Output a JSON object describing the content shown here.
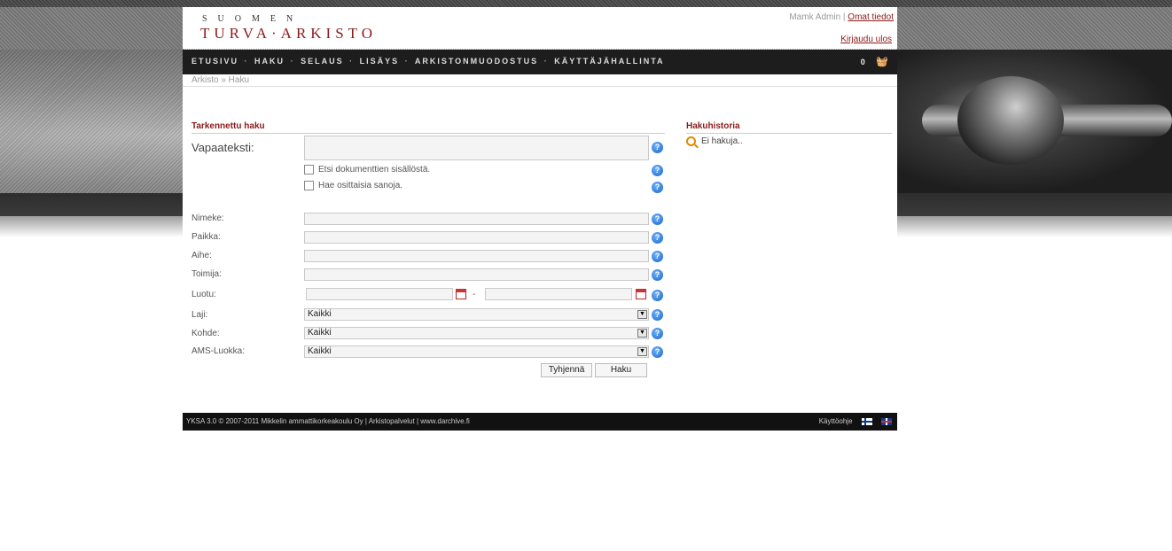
{
  "header": {
    "logo_top": "SUOMEN",
    "logo_main": "TURVA·ARKISTO",
    "user_name": "Mamk Admin",
    "user_sep": " | ",
    "own_info_link": "Omat tiedot",
    "logout_link": "Kirjaudu ulos"
  },
  "nav": {
    "items": [
      "ETUSIVU",
      "HAKU",
      "SELAUS",
      "LISÄYS",
      "ARKISTONMUODOSTUS",
      "KÄYTTÄJÄHALLINTA"
    ],
    "separator": "·",
    "cart_count": "0"
  },
  "breadcrumb": "Arkisto » Haku",
  "search": {
    "title": "Tarkennettu haku",
    "freetext_label": "Vapaateksti:",
    "freetext_value": "",
    "checkbox_content": "Etsi dokumenttien sisällöstä.",
    "checkbox_partial": "Hae osittaisia sanoja.",
    "fields": {
      "nimeke": "Nimeke:",
      "paikka": "Paikka:",
      "aihe": "Aihe:",
      "toimija": "Toimija:",
      "luotu": "Luotu:",
      "laji": "Laji:",
      "kohde": "Kohde:",
      "ams": "AMS-Luokka:"
    },
    "date_dash": "-",
    "laji_value": "Kaikki",
    "kohde_value": "Kaikki",
    "ams_value": "Kaikki",
    "help_glyph": "?",
    "clear_button": "Tyhjennä",
    "search_button": "Haku"
  },
  "history": {
    "title": "Hakuhistoria",
    "empty_text": "Ei hakuja.."
  },
  "footer": {
    "text": "YKSA 3.0 © 2007-2011 Mikkelin ammattikorkeakoulu Oy | Arkistopalvelut | www.darchive.fi",
    "help_link": "Käyttöohje"
  },
  "icons": {
    "help": "help-circle-icon",
    "calendar": "calendar-icon",
    "search": "magnifier-icon",
    "cart": "basket-icon",
    "lang_fi": "flag-finland-icon",
    "lang_en": "flag-uk-icon"
  },
  "colors": {
    "brand_red": "#8b1a1a",
    "nav_bg": "#1d1d1d",
    "help_blue": "#1864c7"
  }
}
